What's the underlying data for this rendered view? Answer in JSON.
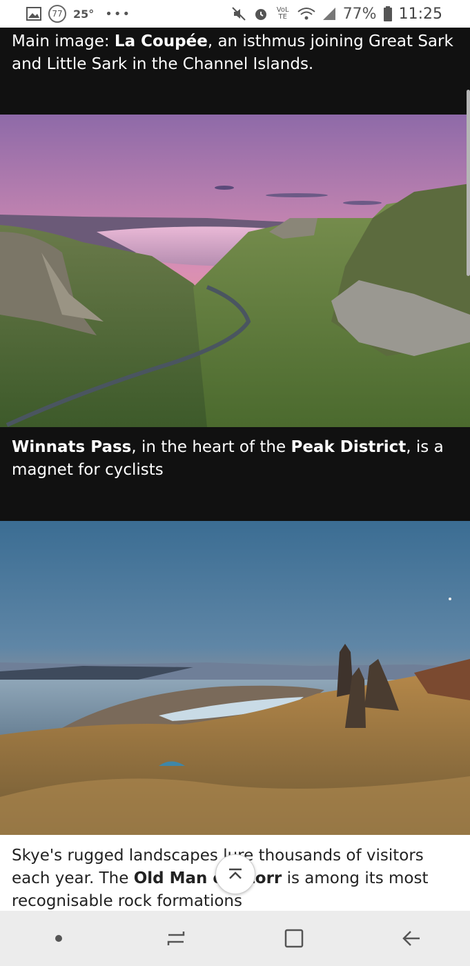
{
  "status": {
    "notifications": {
      "image_icon": "image-icon",
      "badge": "77",
      "temperature": "25°",
      "more": "•••"
    },
    "system": {
      "mute_icon": "mute-icon",
      "alarm_icon": "alarm-icon",
      "volte": "VoLTE",
      "wifi_icon": "wifi-icon",
      "signal_icon": "signal-icon",
      "battery": "77%",
      "battery_icon": "battery-icon",
      "time": "11:25"
    }
  },
  "captions": {
    "c1": {
      "prefix": "Main image: ",
      "bold": "La Coupée",
      "suffix": ", an isthmus joining Great Sark and Little Sark in the Channel Islands."
    },
    "c2": {
      "bold1": "Winnats Pass",
      "mid": ", in the heart of the ",
      "bold2": "Peak District",
      "suffix": ", is a magnet for cyclists"
    },
    "c3": {
      "prefix": "Skye's rugged landscapes lure thousands of visitors each year. The ",
      "bold": "Old Man of Storr",
      "suffix": " is among its most recognisable rock formations"
    }
  },
  "scroll_top": {
    "icon": "scroll-to-top-icon"
  },
  "navbar": {
    "dot": "home-dot-icon",
    "recents": "recents-icon",
    "overview": "overview-icon",
    "back": "back-arrow-icon"
  }
}
